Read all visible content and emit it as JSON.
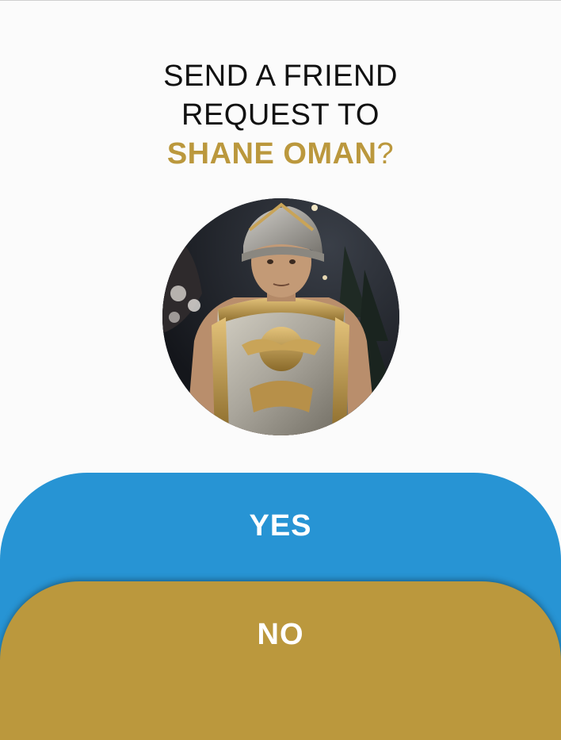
{
  "prompt": {
    "line1": "SEND A FRIEND",
    "line2": "REQUEST TO",
    "name": "SHANE OMAN",
    "question_mark": "?"
  },
  "avatar": {
    "alt": "Profile photo of Shane Oman"
  },
  "actions": {
    "yes_label": "YES",
    "no_label": "NO"
  },
  "colors": {
    "accent_gold": "#bb983d",
    "yes_blue": "#2794d4",
    "background": "#fbfbfb"
  }
}
